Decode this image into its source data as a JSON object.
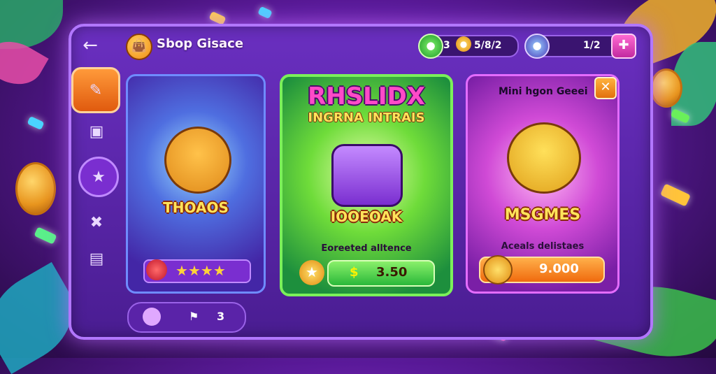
{
  "header": {
    "title": "Sbop Gisace",
    "back_icon": "arrow-left-icon",
    "coins": {
      "left": "3",
      "right": "5/8/2"
    },
    "gems": {
      "value": "1/2"
    },
    "add_icon": "puzzle-icon"
  },
  "sidebar": {
    "items": [
      {
        "icon": "pencil-icon",
        "active": true
      },
      {
        "icon": "chest-icon",
        "active": false
      },
      {
        "icon": "magic-wand-icon",
        "active": false
      },
      {
        "icon": "cross-tools-icon",
        "active": false
      },
      {
        "icon": "box-icon",
        "active": false
      }
    ]
  },
  "cards": [
    {
      "name": "THOAOS",
      "rating": 4,
      "accent": "#6f8cff"
    },
    {
      "banner_line1": "RHSLIDX",
      "banner_line2": "INGRNA INTRAIS",
      "name": "IOOEOAK",
      "subtitle": "Eoreeted alltence",
      "price": "3.50",
      "price_symbol": "$",
      "accent": "#7bf05a"
    },
    {
      "header": "Mini hgon Geeei",
      "name": "MSGMES",
      "subtitle": "Aceals delistaes",
      "price": "9.000",
      "accent": "#e46cff"
    }
  ],
  "bottom_bar": {
    "label": "3"
  },
  "colors": {
    "frame": "#6a2fc0",
    "gold": "#ffe45a",
    "green_btn": "#4fe03a",
    "orange_btn": "#ff8a1e"
  }
}
